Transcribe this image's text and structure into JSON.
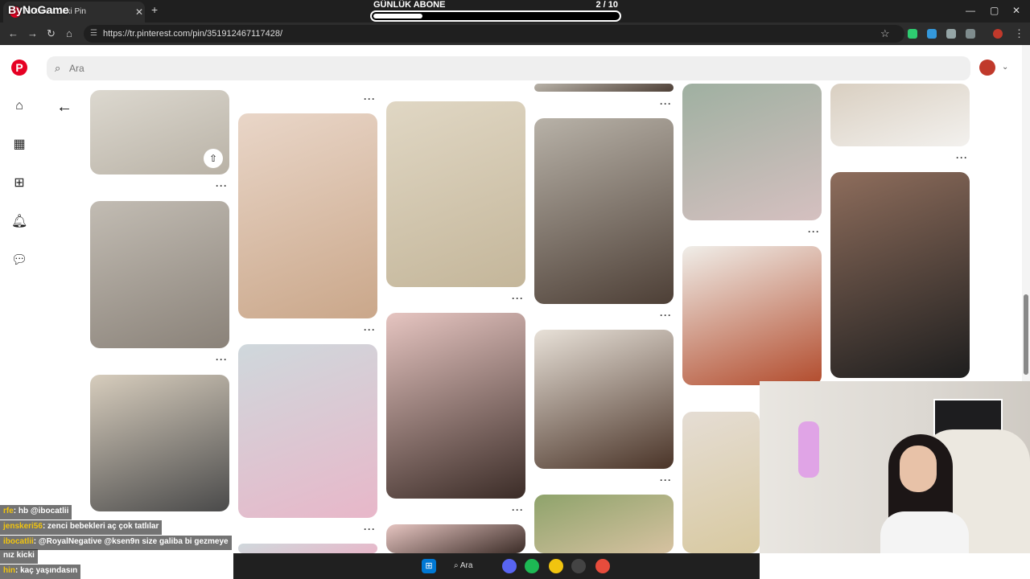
{
  "browser": {
    "tab_title": "Pinterest'deki Pin",
    "watermark": "ByNoGame",
    "url": "https://tr.pinterest.com/pin/351912467117428/",
    "icons": [
      "back-icon",
      "forward-icon",
      "reload-icon",
      "home-icon"
    ]
  },
  "goal": {
    "label": "GÜNLÜK ABONE",
    "count": "2  / 10",
    "progress": 0.2
  },
  "pinterest": {
    "search_placeholder": "Ara",
    "sidebar": [
      "home-icon",
      "explore-icon",
      "create-icon",
      "notifications-icon",
      "messages-icon"
    ],
    "pins": [
      {
        "col": 0,
        "colors": [
          "#dcd8cf",
          "#b9b2a6"
        ]
      },
      {
        "col": 0,
        "colors": [
          "#c2bcb3",
          "#8a8279"
        ]
      },
      {
        "col": 0,
        "colors": [
          "#d7cdbd",
          "#4a4a4a"
        ]
      },
      {
        "col": 1,
        "colors": [
          "#e9d6c8",
          "#caa78a"
        ]
      },
      {
        "col": 1,
        "colors": [
          "#cfd8dc",
          "#e8b7c9"
        ]
      },
      {
        "col": 2,
        "colors": [
          "#e0d7c4",
          "#c4b69a"
        ]
      },
      {
        "col": 2,
        "colors": [
          "#e6c5c1",
          "#3b2c27"
        ]
      },
      {
        "col": 3,
        "colors": [
          "#b8b2a8",
          "#4d3f36"
        ]
      },
      {
        "col": 3,
        "colors": [
          "#e8e1d8",
          "#4a3428"
        ]
      },
      {
        "col": 3,
        "colors": [
          "#8ea36b",
          "#d7c2a1"
        ]
      },
      {
        "col": 4,
        "colors": [
          "#9fb0a1",
          "#d5c0c0"
        ]
      },
      {
        "col": 4,
        "colors": [
          "#f0eee9",
          "#b24b2c"
        ]
      },
      {
        "col": 4,
        "colors": [
          "#e5ddd4",
          "#d8c9a0"
        ]
      },
      {
        "col": 5,
        "colors": [
          "#d9cfc1",
          "#f3f1ee"
        ]
      },
      {
        "col": 5,
        "colors": [
          "#8e6d5c",
          "#1e1e1e"
        ]
      }
    ]
  },
  "chat": [
    {
      "user": "rfe",
      "msg": ": hb @ibocatlii"
    },
    {
      "user": "jenskeri56",
      "msg": ": zenci bebekleri aç çok tatlılar"
    },
    {
      "user": "ibocatlii",
      "msg": ": @RoyalNegative @ksen9n size galiba bi gezmeye"
    },
    {
      "user": "",
      "msg": "nız kicki"
    },
    {
      "user": "hin",
      "msg": ": kaç yaşındasın"
    }
  ],
  "taskbar": {
    "search_label": "Ara",
    "icons": [
      "windows-icon",
      "search-icon",
      "discord-icon",
      "spotify-icon",
      "chrome-icon",
      "obs-icon",
      "chrome-active-icon"
    ]
  }
}
